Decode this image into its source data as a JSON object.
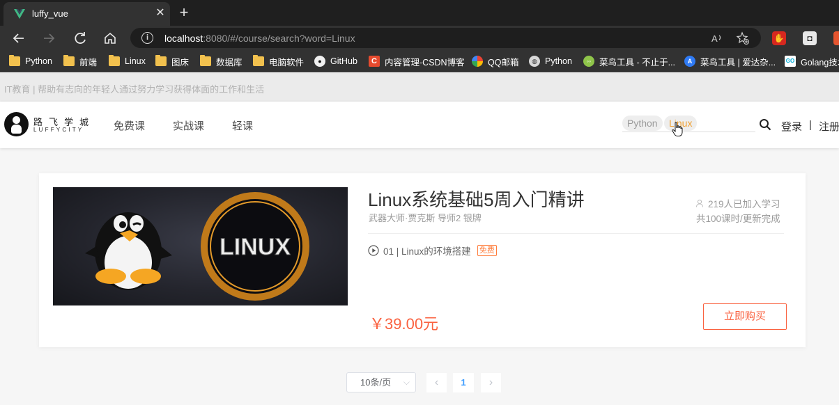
{
  "browser": {
    "tab_title": "luffy_vue",
    "tab_close": "✕",
    "new_tab": "+",
    "url_host": "localhost",
    "url_rest": ":8080/#/course/search?word=Linux",
    "extensions": [
      "adblock-icon",
      "extension-icon",
      "extension-red-icon"
    ],
    "bookmarks": [
      {
        "label": "Python",
        "icon": "folder-icon"
      },
      {
        "label": "前端",
        "icon": "folder-icon"
      },
      {
        "label": "Linux",
        "icon": "folder-icon"
      },
      {
        "label": "图床",
        "icon": "folder-icon"
      },
      {
        "label": "数据库",
        "icon": "folder-icon"
      },
      {
        "label": "电脑软件",
        "icon": "folder-icon"
      },
      {
        "label": "GitHub",
        "icon": "github-icon"
      },
      {
        "label": "内容管理-CSDN博客",
        "icon": "csdn-icon"
      },
      {
        "label": "QQ邮箱",
        "icon": "qqmail-icon"
      },
      {
        "label": "Python",
        "icon": "python-icon"
      },
      {
        "label": "菜鸟工具 - 不止于...",
        "icon": "runoob-icon"
      },
      {
        "label": "菜鸟工具 | 爱达杂...",
        "icon": "aida-icon"
      },
      {
        "label": "Golang技术",
        "icon": "golang-icon"
      }
    ]
  },
  "site": {
    "slogan": "IT教育 | 帮助有志向的年轻人通过努力学习获得体面的工作和生活",
    "logo_cn": "路飞学城",
    "logo_en": "LUFFYCITY",
    "nav": [
      "免费课",
      "实战课",
      "轻课"
    ],
    "hot_search": [
      "Python",
      "Linux"
    ],
    "login": "登录",
    "separator": "|",
    "register": "注册"
  },
  "course": {
    "image_text": "LINUX",
    "title": "Linux系统基础5周入门精讲",
    "teacher": "武器大师·贾克斯 导师2 银牌",
    "students": "219人已加入学习",
    "lessons": "共100课时/更新完成",
    "lesson_item": "01 | Linux的环境搭建",
    "free_label": "免费",
    "price": "￥39.00元",
    "buy_label": "立即购买"
  },
  "pagination": {
    "page_size": "10条/页",
    "prev": "‹",
    "current": "1",
    "next": "›"
  },
  "colors": {
    "accent": "#fa6240",
    "active_tag": "#f0a132",
    "pager_active": "#409eff"
  }
}
